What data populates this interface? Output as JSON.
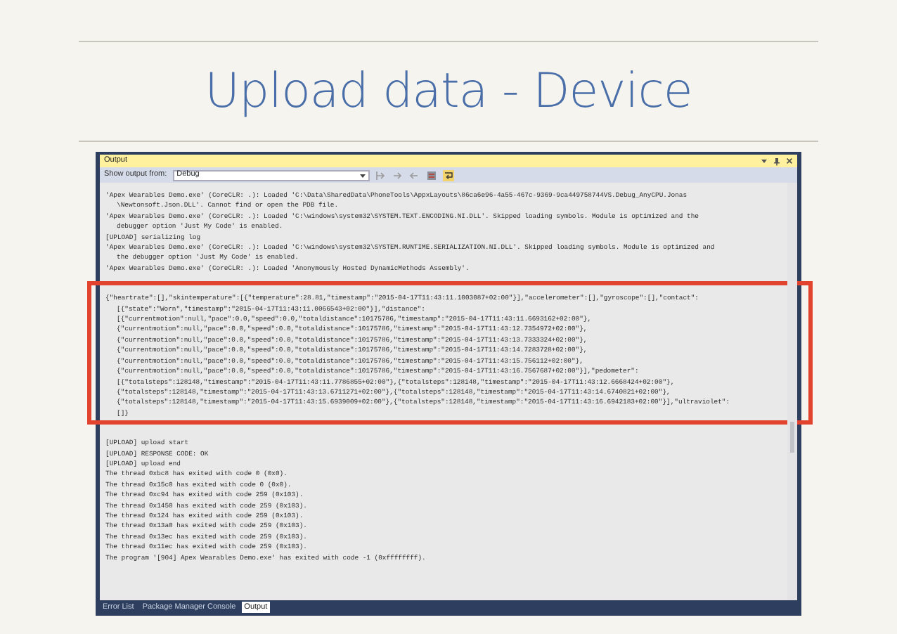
{
  "slide": {
    "title": "Upload data - Device"
  },
  "output_window": {
    "title": "Output",
    "source_label": "Show output from:",
    "source": "Debug",
    "sections": [
      {
        "highlighted": false,
        "entries": [
          {
            "lines": [
              "'Apex Wearables Demo.exe' (CoreCLR: .): Loaded 'C:\\Data\\SharedData\\PhoneTools\\AppxLayouts\\86ca6e96-4a55-467c-9369-9ca449758744VS.Debug_AnyCPU.Jonas",
              "\\Newtonsoft.Json.DLL'. Cannot find or open the PDB file."
            ]
          },
          {
            "lines": [
              "'Apex Wearables Demo.exe' (CoreCLR: .): Loaded 'C:\\windows\\system32\\SYSTEM.TEXT.ENCODING.NI.DLL'. Skipped loading symbols. Module is optimized and the",
              "debugger option 'Just My Code' is enabled."
            ]
          },
          {
            "lines": [
              "[UPLOAD] serializing log"
            ]
          },
          {
            "lines": [
              "'Apex Wearables Demo.exe' (CoreCLR: .): Loaded 'C:\\windows\\system32\\SYSTEM.RUNTIME.SERIALIZATION.NI.DLL'. Skipped loading symbols. Module is optimized and",
              "the debugger option 'Just My Code' is enabled."
            ]
          },
          {
            "lines": [
              "'Apex Wearables Demo.exe' (CoreCLR: .): Loaded 'Anonymously Hosted DynamicMethods Assembly'."
            ]
          }
        ]
      },
      {
        "highlighted": true,
        "entries": [
          {
            "lines": [
              "{\"heartrate\":[],\"skintemperature\":[{\"temperature\":28.81,\"timestamp\":\"2015-04-17T11:43:11.1003087+02:00\"}],\"accelerometer\":[],\"gyroscope\":[],\"contact\":",
              "[{\"state\":\"Worn\",\"timestamp\":\"2015-04-17T11:43:11.0066543+02:00\"}],\"distance\":",
              "[{\"currentmotion\":null,\"pace\":0.0,\"speed\":0.0,\"totaldistance\":10175786,\"timestamp\":\"2015-04-17T11:43:11.6693162+02:00\"},",
              "{\"currentmotion\":null,\"pace\":0.0,\"speed\":0.0,\"totaldistance\":10175786,\"timestamp\":\"2015-04-17T11:43:12.7354972+02:00\"},",
              "{\"currentmotion\":null,\"pace\":0.0,\"speed\":0.0,\"totaldistance\":10175786,\"timestamp\":\"2015-04-17T11:43:13.7333324+02:00\"},",
              "{\"currentmotion\":null,\"pace\":0.0,\"speed\":0.0,\"totaldistance\":10175786,\"timestamp\":\"2015-04-17T11:43:14.7283728+02:00\"},",
              "{\"currentmotion\":null,\"pace\":0.0,\"speed\":0.0,\"totaldistance\":10175786,\"timestamp\":\"2015-04-17T11:43:15.756112+02:00\"},",
              "{\"currentmotion\":null,\"pace\":0.0,\"speed\":0.0,\"totaldistance\":10175786,\"timestamp\":\"2015-04-17T11:43:16.7567687+02:00\"}],\"pedometer\":",
              "[{\"totalsteps\":128148,\"timestamp\":\"2015-04-17T11:43:11.7786855+02:00\"},{\"totalsteps\":128148,\"timestamp\":\"2015-04-17T11:43:12.6668424+02:00\"},",
              "{\"totalsteps\":128148,\"timestamp\":\"2015-04-17T11:43:13.6711271+02:00\"},{\"totalsteps\":128148,\"timestamp\":\"2015-04-17T11:43:14.6740821+02:00\"},",
              "{\"totalsteps\":128148,\"timestamp\":\"2015-04-17T11:43:15.6939009+02:00\"},{\"totalsteps\":128148,\"timestamp\":\"2015-04-17T11:43:16.6942183+02:00\"}],\"ultraviolet\":",
              "[]}"
            ]
          }
        ]
      },
      {
        "highlighted": false,
        "entries": [
          {
            "lines": [
              "[UPLOAD] upload start"
            ]
          },
          {
            "lines": [
              "[UPLOAD] RESPONSE CODE: OK"
            ]
          },
          {
            "lines": [
              "[UPLOAD] upload end"
            ]
          },
          {
            "lines": [
              "The thread 0xbc8 has exited with code 0 (0x0)."
            ]
          },
          {
            "lines": [
              "The thread 0x15c0 has exited with code 0 (0x0)."
            ]
          },
          {
            "lines": [
              "The thread 0xc94 has exited with code 259 (0x103)."
            ]
          },
          {
            "lines": [
              "The thread 0x1450 has exited with code 259 (0x103)."
            ]
          },
          {
            "lines": [
              "The thread 0x124 has exited with code 259 (0x103)."
            ]
          },
          {
            "lines": [
              "The thread 0x13a0 has exited with code 259 (0x103)."
            ]
          },
          {
            "lines": [
              "The thread 0x13ec has exited with code 259 (0x103)."
            ]
          },
          {
            "lines": [
              "The thread 0x11ec has exited with code 259 (0x103)."
            ]
          },
          {
            "lines": [
              "The program '[904] Apex Wearables Demo.exe' has exited with code -1 (0xffffffff)."
            ]
          }
        ]
      }
    ],
    "tabs": [
      {
        "label": "Error List",
        "selected": false
      },
      {
        "label": "Package Manager Console",
        "selected": false
      },
      {
        "label": "Output",
        "selected": true
      }
    ]
  }
}
